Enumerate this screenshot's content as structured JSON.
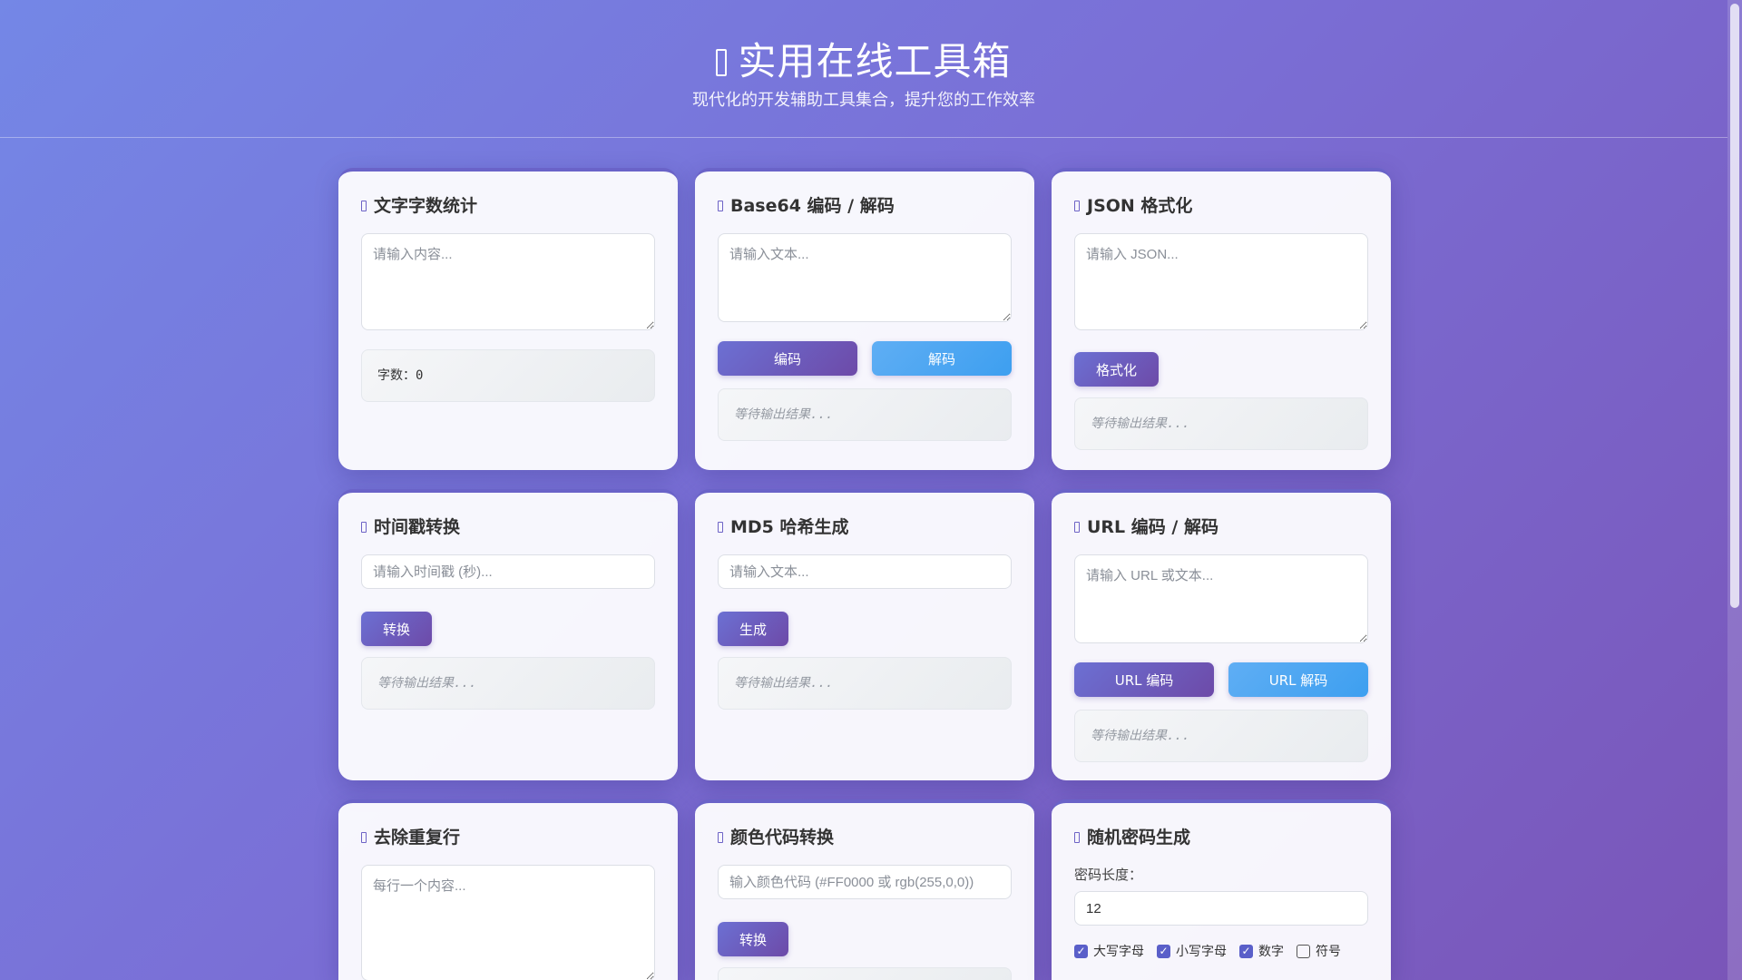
{
  "header": {
    "title": "实用在线工具箱",
    "subtitle": "现代化的开发辅助工具集合，提升您的工作效率"
  },
  "cards": {
    "word_count": {
      "title": "文字字数统计",
      "placeholder": "请输入内容...",
      "count_text": "字数：0"
    },
    "base64": {
      "title": "Base64 编码 / 解码",
      "placeholder": "请输入文本...",
      "encode": "编码",
      "decode": "解码",
      "result": "等待输出结果..."
    },
    "json": {
      "title": "JSON 格式化",
      "placeholder": "请输入 JSON...",
      "format": "格式化",
      "result": "等待输出结果..."
    },
    "timestamp": {
      "title": "时间戳转换",
      "placeholder": "请输入时间戳 (秒)...",
      "convert": "转换",
      "result": "等待输出结果..."
    },
    "md5": {
      "title": "MD5 哈希生成",
      "placeholder": "请输入文本...",
      "generate": "生成",
      "result": "等待输出结果..."
    },
    "url": {
      "title": "URL 编码 / 解码",
      "placeholder": "请输入 URL 或文本...",
      "encode": "URL 编码",
      "decode": "URL 解码",
      "result": "等待输出结果..."
    },
    "dedupe": {
      "title": "去除重复行",
      "placeholder": "每行一个内容..."
    },
    "color": {
      "title": "颜色代码转换",
      "placeholder": "输入颜色代码 (#FF0000 或 rgb(255,0,0))",
      "convert": "转换"
    },
    "password": {
      "title": "随机密码生成",
      "length_label": "密码长度：",
      "length_value": "12",
      "options": [
        {
          "label": "大写字母",
          "checked": true
        },
        {
          "label": "小写字母",
          "checked": true
        },
        {
          "label": "数字",
          "checked": true
        },
        {
          "label": "符号",
          "checked": false
        }
      ]
    }
  },
  "colors": {
    "accent": "#6c70d3",
    "accent_alt": "#4aa6f2"
  }
}
